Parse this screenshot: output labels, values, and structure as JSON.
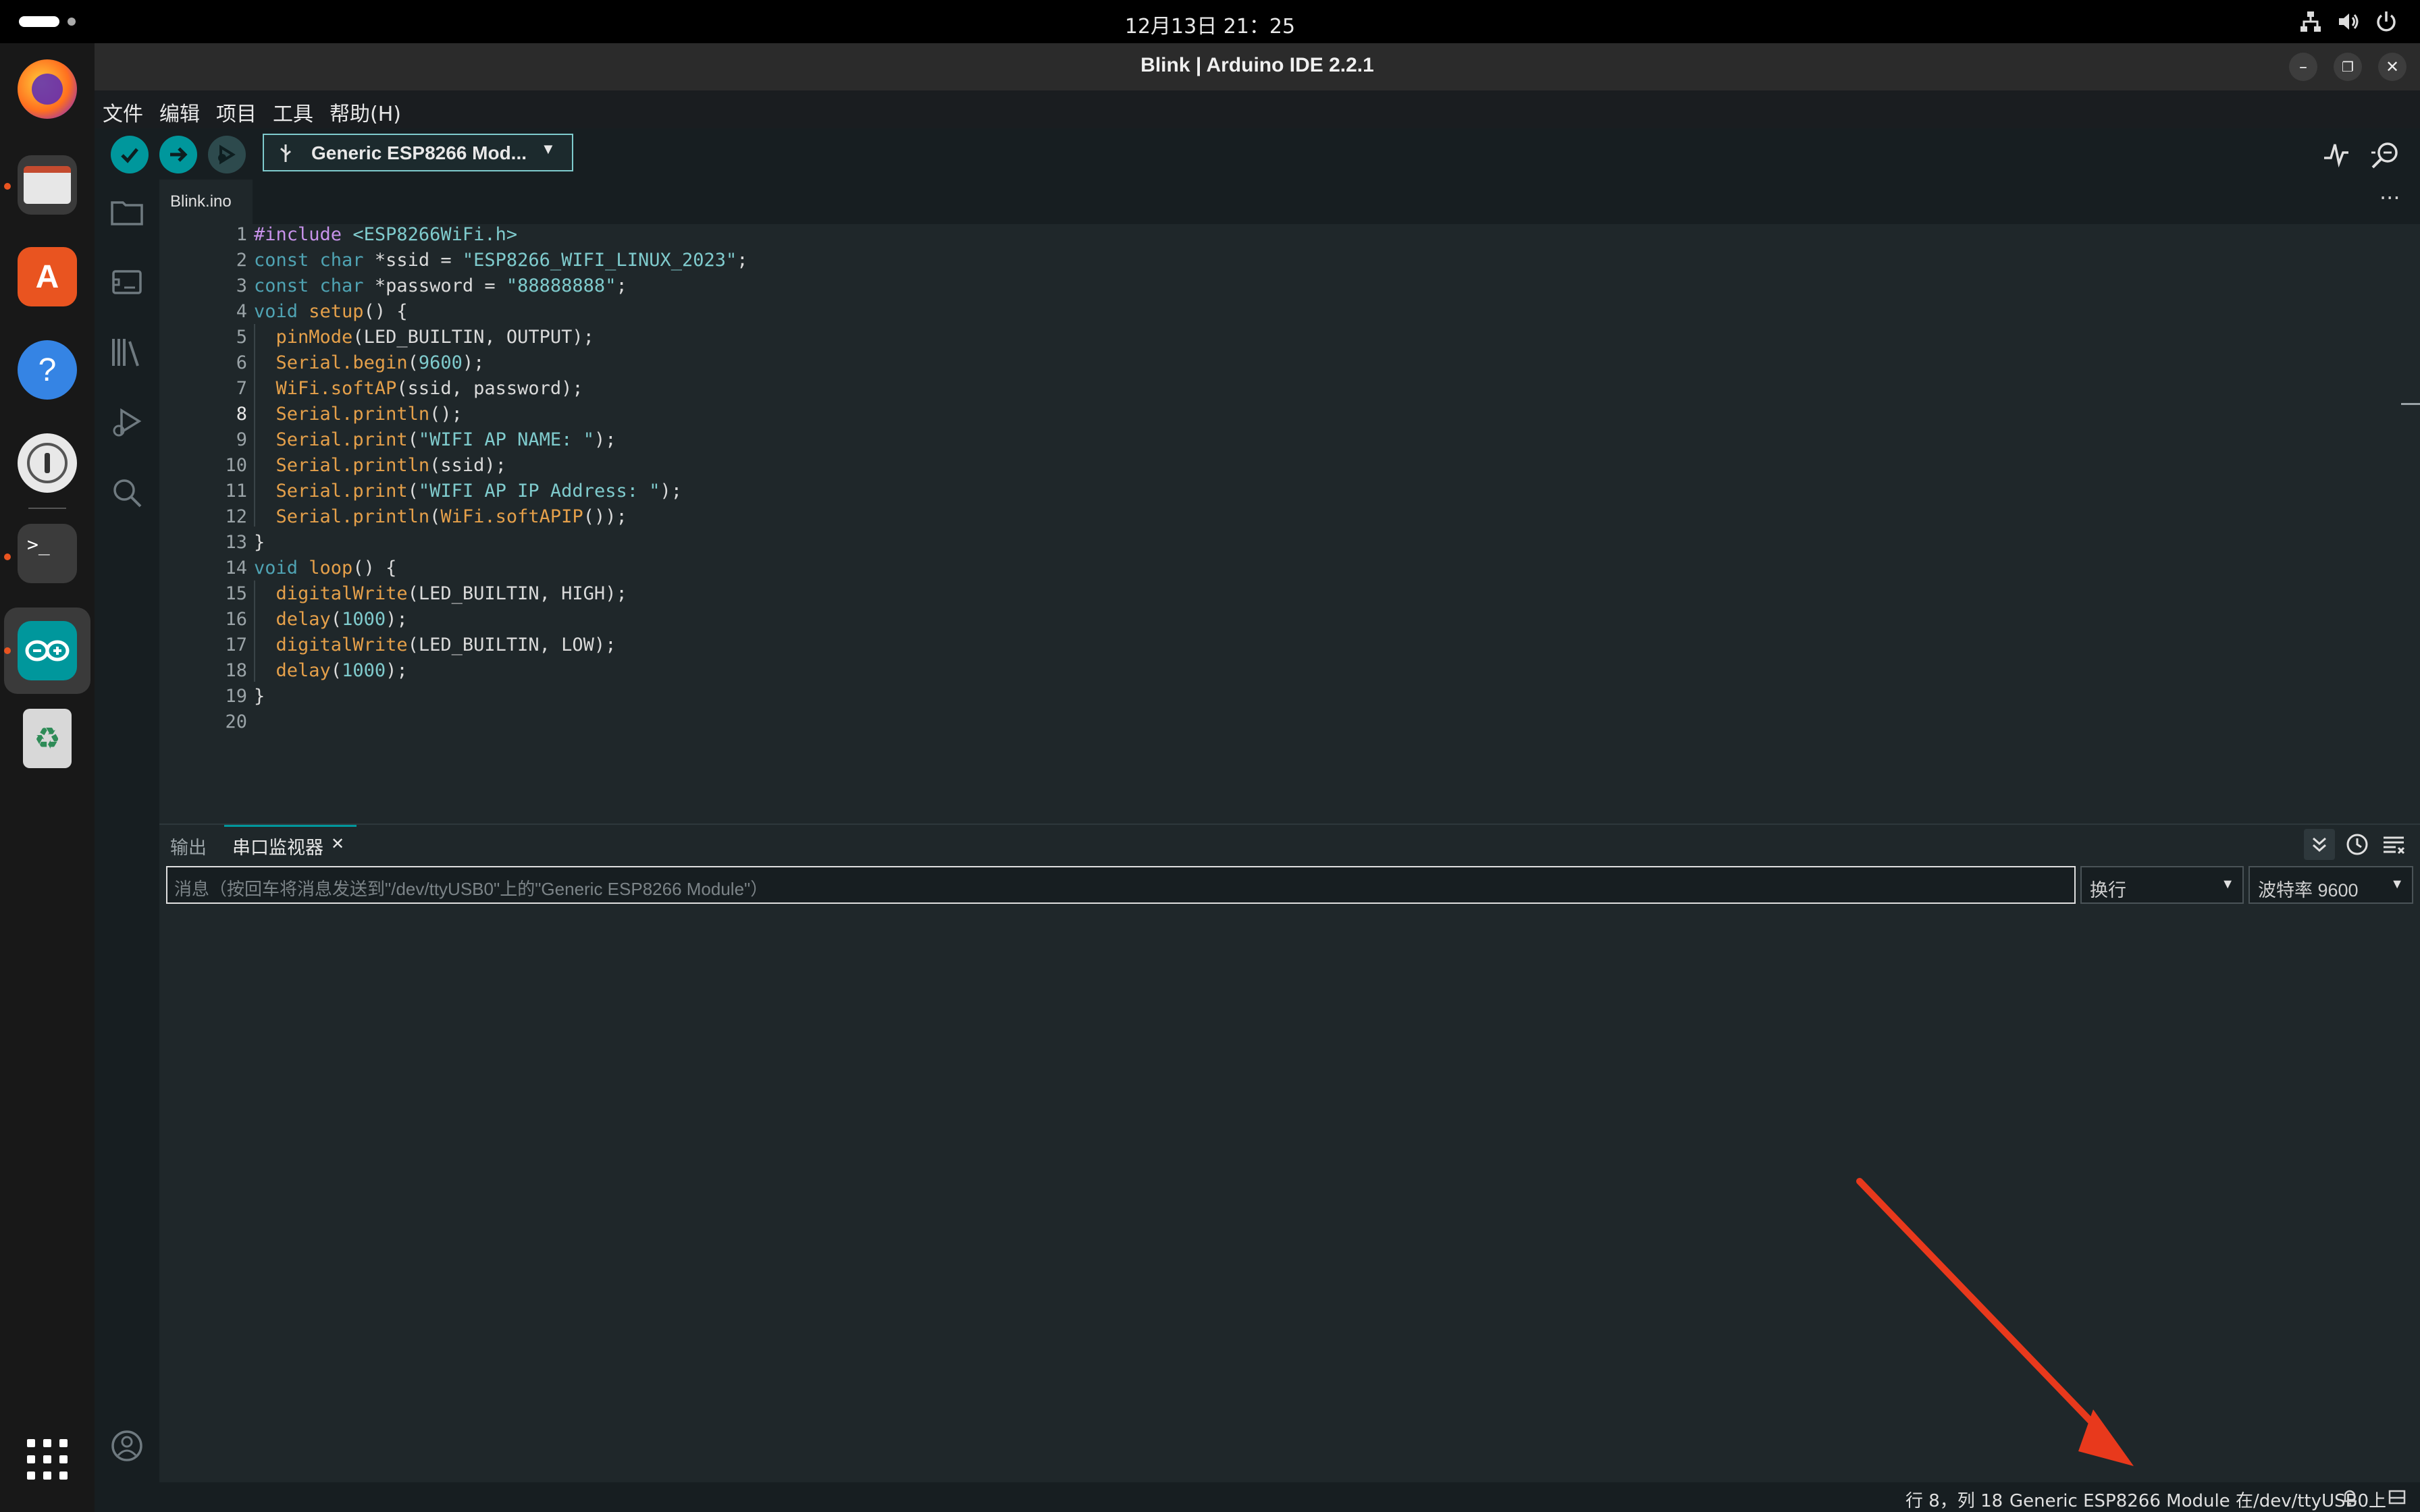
{
  "topbar": {
    "clock": "12月13日 21：25"
  },
  "window": {
    "title": "Blink | Arduino IDE 2.2.1"
  },
  "menu": {
    "items": [
      "文件",
      "编辑",
      "项目",
      "工具",
      "帮助(H)"
    ]
  },
  "toolbar": {
    "board": "Generic ESP8266 Mod..."
  },
  "tabs": {
    "active": "Blink.ino"
  },
  "editor": {
    "lines": [
      "1",
      "2",
      "3",
      "4",
      "5",
      "6",
      "7",
      "8",
      "9",
      "10",
      "11",
      "12",
      "13",
      "14",
      "15",
      "16",
      "17",
      "18",
      "19",
      "20"
    ]
  },
  "panel": {
    "tab_output": "输出",
    "tab_serial": "串口监视器",
    "input_placeholder": "消息（按回车将消息发送到\"/dev/ttyUSB0\"上的\"Generic ESP8266 Module\"）",
    "line_ending": "换行",
    "baud": "波特率 9600"
  },
  "status": {
    "position": "行 8，列 18",
    "board_port": "Generic ESP8266 Module 在/dev/ttyUSB0上"
  },
  "colors": {
    "accent": "#00979c",
    "annotation_arrow": "#e8391c"
  },
  "icons": [
    "firefox-icon",
    "files-icon",
    "app-center-icon",
    "help-icon",
    "password-icon",
    "terminal-icon",
    "arduino-icon",
    "trash-icon",
    "app-grid-icon"
  ]
}
